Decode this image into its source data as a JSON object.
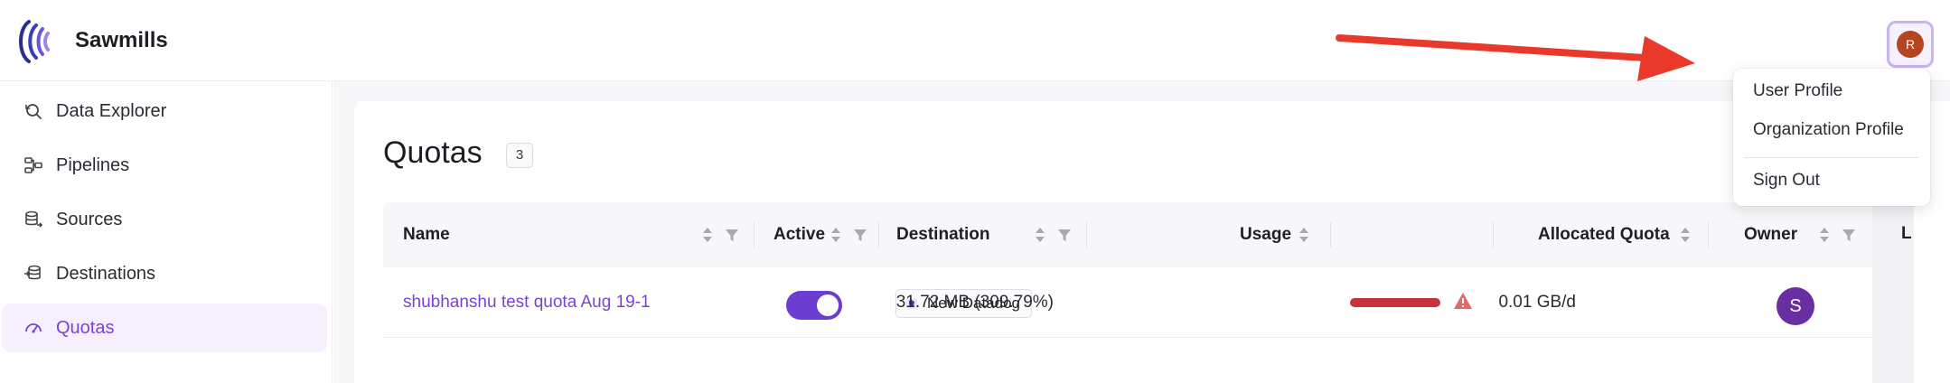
{
  "app": {
    "name": "Sawmills"
  },
  "user": {
    "initial": "R"
  },
  "sidebar": {
    "items": [
      {
        "label": "Data Explorer",
        "icon": "data-explorer-icon"
      },
      {
        "label": "Pipelines",
        "icon": "pipelines-icon"
      },
      {
        "label": "Sources",
        "icon": "sources-icon"
      },
      {
        "label": "Destinations",
        "icon": "destinations-icon"
      },
      {
        "label": "Quotas",
        "icon": "quotas-icon",
        "active": true
      }
    ]
  },
  "page": {
    "title": "Quotas",
    "count": "3"
  },
  "table": {
    "columns": [
      "Name",
      "Active",
      "Destination",
      "Usage",
      "Allocated Quota",
      "Owner",
      "L"
    ],
    "rows": [
      {
        "name": "shubhanshu test quota Aug 19-1",
        "active": true,
        "destination": "New Datadog",
        "usage": "31.72 MB (309.79%)",
        "usage_fraction": 1.0,
        "allocated": "0.01 GB/d",
        "owner_initial": "S"
      }
    ]
  },
  "user_menu": {
    "items": [
      "User Profile",
      "Organization Profile",
      "Sign Out"
    ]
  },
  "colors": {
    "accent": "#7a43d6",
    "toggle_on": "#6b3ed1",
    "usage_over": "#c8323a",
    "annotation_arrow": "#e8392b"
  }
}
